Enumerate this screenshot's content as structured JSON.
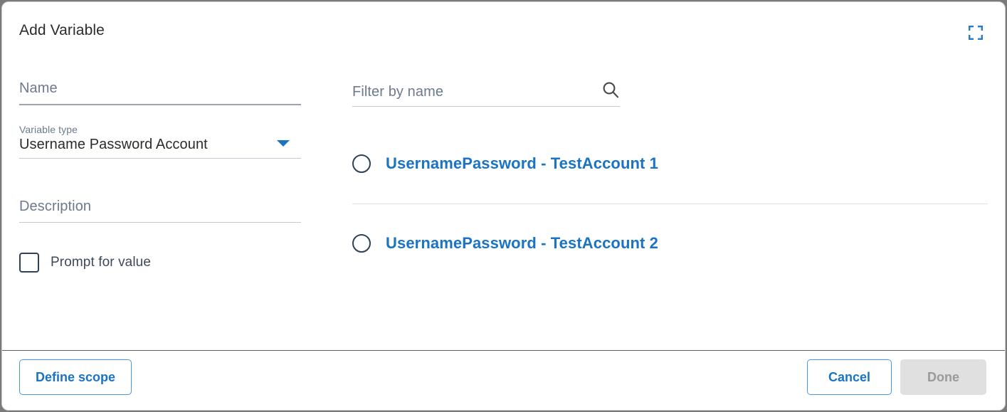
{
  "dialog": {
    "title": "Add Variable",
    "expand_icon": "expand-fullscreen-icon"
  },
  "form": {
    "name": {
      "placeholder": "Name",
      "value": ""
    },
    "variable_type": {
      "label": "Variable type",
      "selected": "Username Password Account",
      "caret_icon": "chevron-down-icon"
    },
    "description": {
      "placeholder": "Description",
      "value": ""
    },
    "prompt_for_value": {
      "label": "Prompt for value",
      "checked": false
    }
  },
  "list_panel": {
    "search": {
      "placeholder": "Filter by name",
      "value": "",
      "icon": "search-icon"
    },
    "options": [
      {
        "label": "UsernamePassword - TestAccount 1",
        "selected": false
      },
      {
        "label": "UsernamePassword - TestAccount 2",
        "selected": false
      }
    ]
  },
  "footer": {
    "define_scope_label": "Define scope",
    "cancel_label": "Cancel",
    "done_label": "Done"
  },
  "colors": {
    "accent_blue": "#1a73c4",
    "link_blue": "#1a73c4",
    "muted_text": "#6b7b8c",
    "disabled_bg": "#e0e0e0",
    "disabled_text": "#9a9a9a"
  }
}
